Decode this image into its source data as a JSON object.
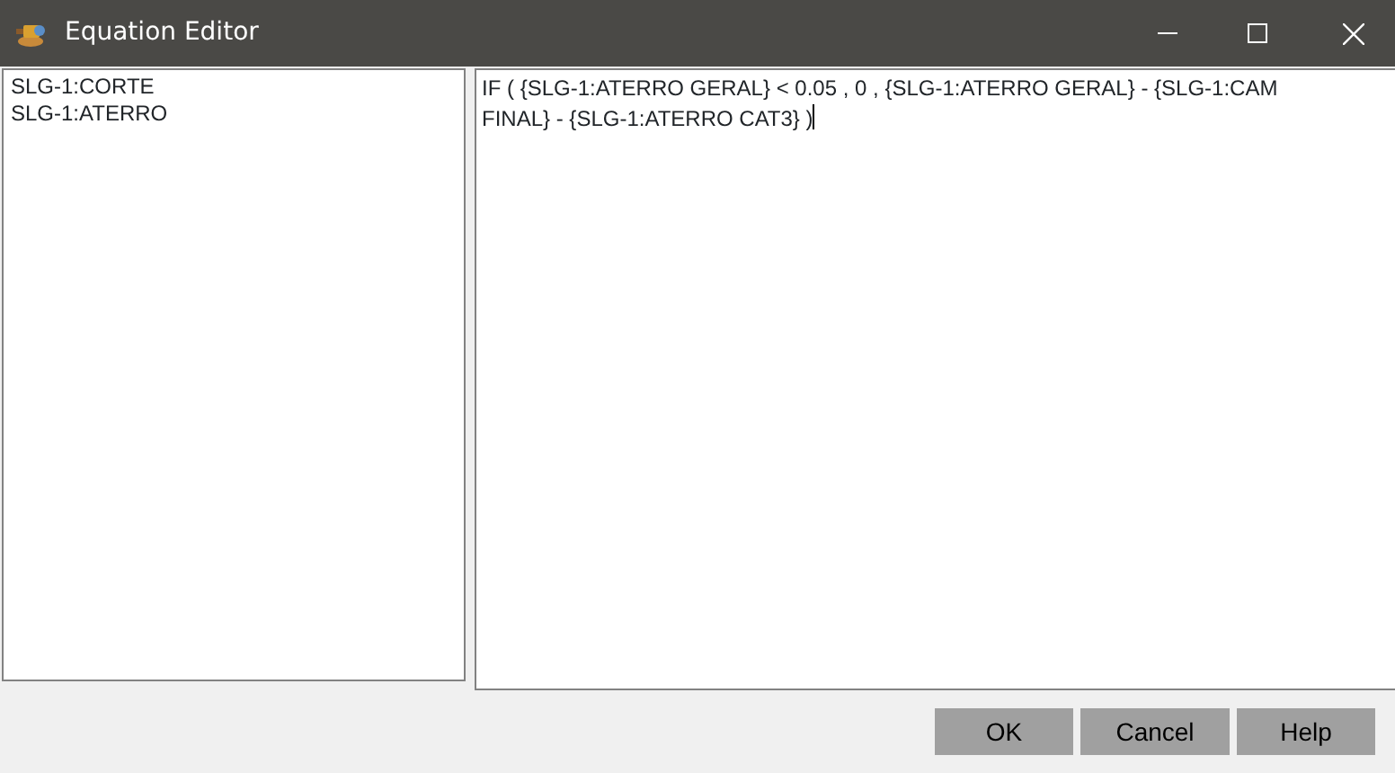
{
  "window": {
    "title": "Equation Editor"
  },
  "variables": [
    {
      "label": "SLG-1:CORTE"
    },
    {
      "label": "SLG-1:ATERRO"
    }
  ],
  "equation": {
    "lines": [
      "IF ( {SLG-1:ATERRO GERAL} < 0.05 , 0 , {SLG-1:ATERRO GERAL} - {SLG-1:CAM",
      "FINAL} - {SLG-1:ATERRO CAT3} )"
    ],
    "cursor_visible": true
  },
  "buttons": [
    {
      "label": "OK"
    },
    {
      "label": "Cancel"
    },
    {
      "label": "Help"
    }
  ]
}
